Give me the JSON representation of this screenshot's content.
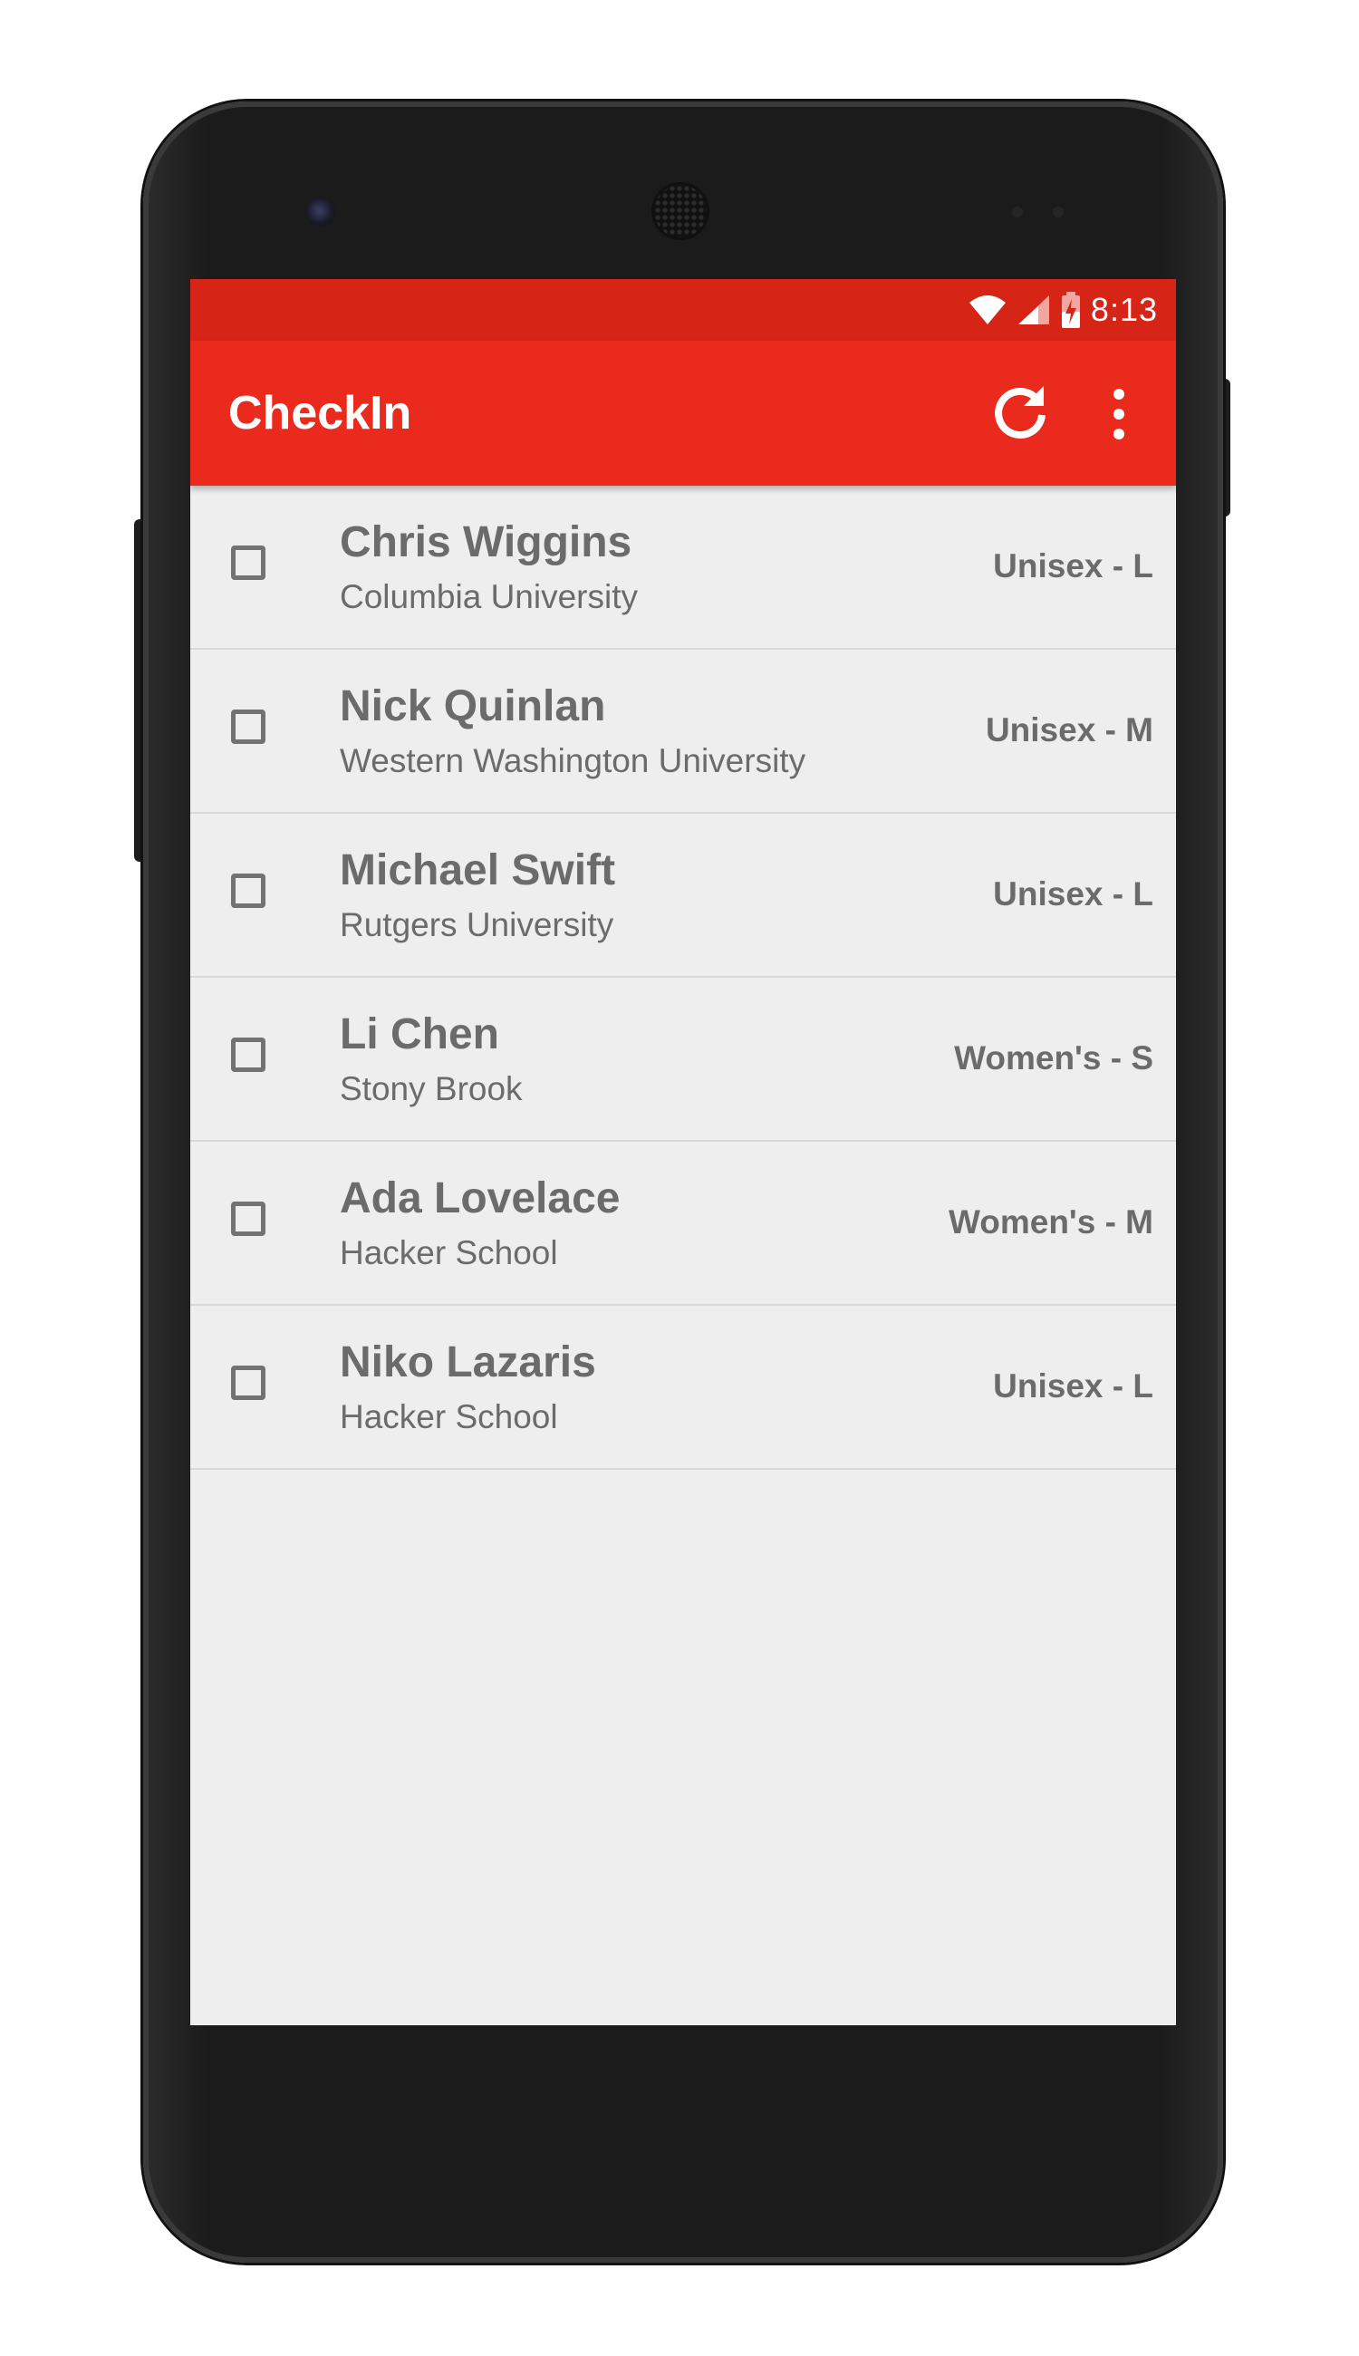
{
  "status_bar": {
    "time": "8:13"
  },
  "app_bar": {
    "title": "CheckIn",
    "color": "#eb2a1e",
    "status_color": "#d62517",
    "actions": [
      "refresh-icon",
      "more-vert-icon"
    ]
  },
  "attendees": [
    {
      "name": "Chris Wiggins",
      "school": "Columbia University",
      "size": "Unisex - L",
      "checked": false
    },
    {
      "name": "Nick Quinlan",
      "school": "Western Washington University",
      "size": "Unisex - M",
      "checked": false
    },
    {
      "name": "Michael Swift",
      "school": "Rutgers University",
      "size": "Unisex - L",
      "checked": false
    },
    {
      "name": "Li Chen",
      "school": "Stony Brook",
      "size": "Women's - S",
      "checked": false
    },
    {
      "name": "Ada Lovelace",
      "school": "Hacker School",
      "size": "Women's - M",
      "checked": false
    },
    {
      "name": "Niko Lazaris",
      "school": "Hacker School",
      "size": "Unisex - L",
      "checked": false
    }
  ]
}
